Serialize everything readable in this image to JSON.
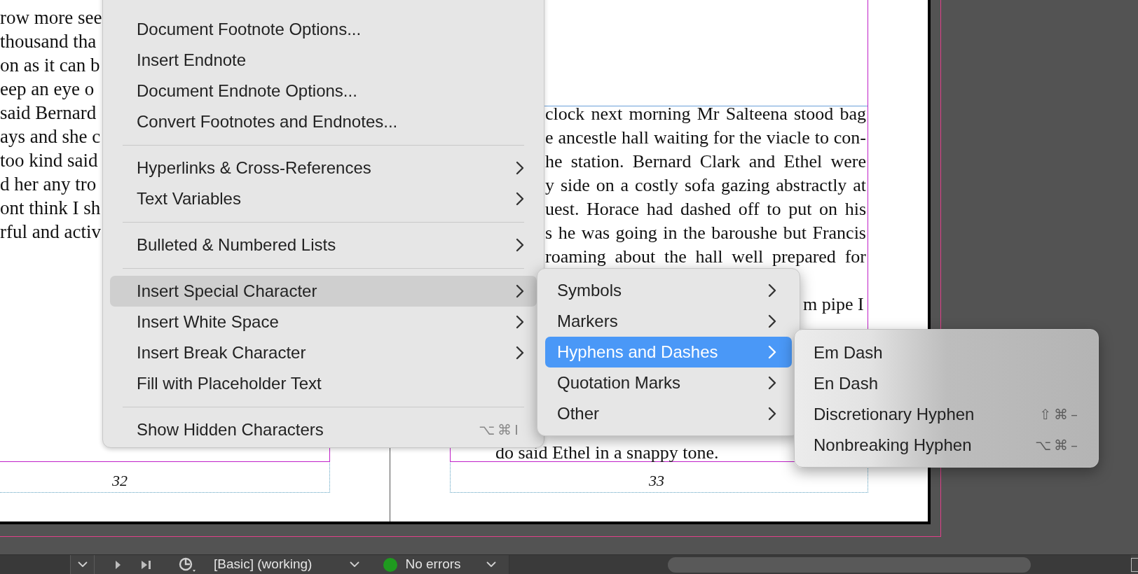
{
  "left_page": {
    "lines": [
      "row more see",
      "thousand tha",
      "on as it can b",
      "eep an eye o",
      "said Bernard",
      "ays and she c",
      "too kind said",
      "d her any tro",
      "ont think I sh",
      "rful and activ"
    ],
    "page_number": "32"
  },
  "right_page": {
    "lines": [
      "clock next morning Mr Salteena stood bag",
      "e ancestle hall waiting for the viacle to con-",
      "he station. Bernard Clark and Ethel were",
      "y side on a costly sofa gazing abstractly at",
      "uest. Horace had dashed off to put on his",
      "s he was going in the baroushe but Francis",
      "roaming about the hall well prepared for"
    ],
    "lower_line": "m pipe I",
    "last_line": "do said Ethel in a snappy tone.",
    "page_number": "33"
  },
  "context_menu": {
    "items": [
      {
        "kind": "item",
        "label": "Document Footnote Options...",
        "submenu": false,
        "selected": false
      },
      {
        "kind": "item",
        "label": "Insert Endnote",
        "submenu": false,
        "selected": false
      },
      {
        "kind": "item",
        "label": "Document Endnote Options...",
        "submenu": false,
        "selected": false
      },
      {
        "kind": "item",
        "label": "Convert Footnotes and Endnotes...",
        "submenu": false,
        "selected": false
      },
      {
        "kind": "separator"
      },
      {
        "kind": "item",
        "label": "Hyperlinks & Cross-References",
        "submenu": true,
        "selected": false
      },
      {
        "kind": "item",
        "label": "Text Variables",
        "submenu": true,
        "selected": false
      },
      {
        "kind": "separator"
      },
      {
        "kind": "item",
        "label": "Bulleted & Numbered Lists",
        "submenu": true,
        "selected": false
      },
      {
        "kind": "separator"
      },
      {
        "kind": "item",
        "label": "Insert Special Character",
        "submenu": true,
        "selected": true
      },
      {
        "kind": "item",
        "label": "Insert White Space",
        "submenu": true,
        "selected": false
      },
      {
        "kind": "item",
        "label": "Insert Break Character",
        "submenu": true,
        "selected": false
      },
      {
        "kind": "item",
        "label": "Fill with Placeholder Text",
        "submenu": false,
        "selected": false
      },
      {
        "kind": "separator"
      },
      {
        "kind": "item",
        "label": "Show Hidden Characters",
        "submenu": false,
        "selected": false,
        "shortcut": "⌥⌘I"
      }
    ]
  },
  "special_character_menu": {
    "items": [
      {
        "label": "Symbols",
        "selected": false
      },
      {
        "label": "Markers",
        "selected": false
      },
      {
        "label": "Hyphens and Dashes",
        "selected": true
      },
      {
        "label": "Quotation Marks",
        "selected": false
      },
      {
        "label": "Other",
        "selected": false
      }
    ]
  },
  "dashes_menu": {
    "items": [
      {
        "label": "Em Dash"
      },
      {
        "label": "En Dash"
      },
      {
        "label": "Discretionary Hyphen",
        "shortcut": "⇧⌘–"
      },
      {
        "label": "Nonbreaking Hyphen",
        "shortcut": "⌥⌘–"
      }
    ]
  },
  "status_bar": {
    "profile": "[Basic] (working)",
    "status": "No errors"
  }
}
